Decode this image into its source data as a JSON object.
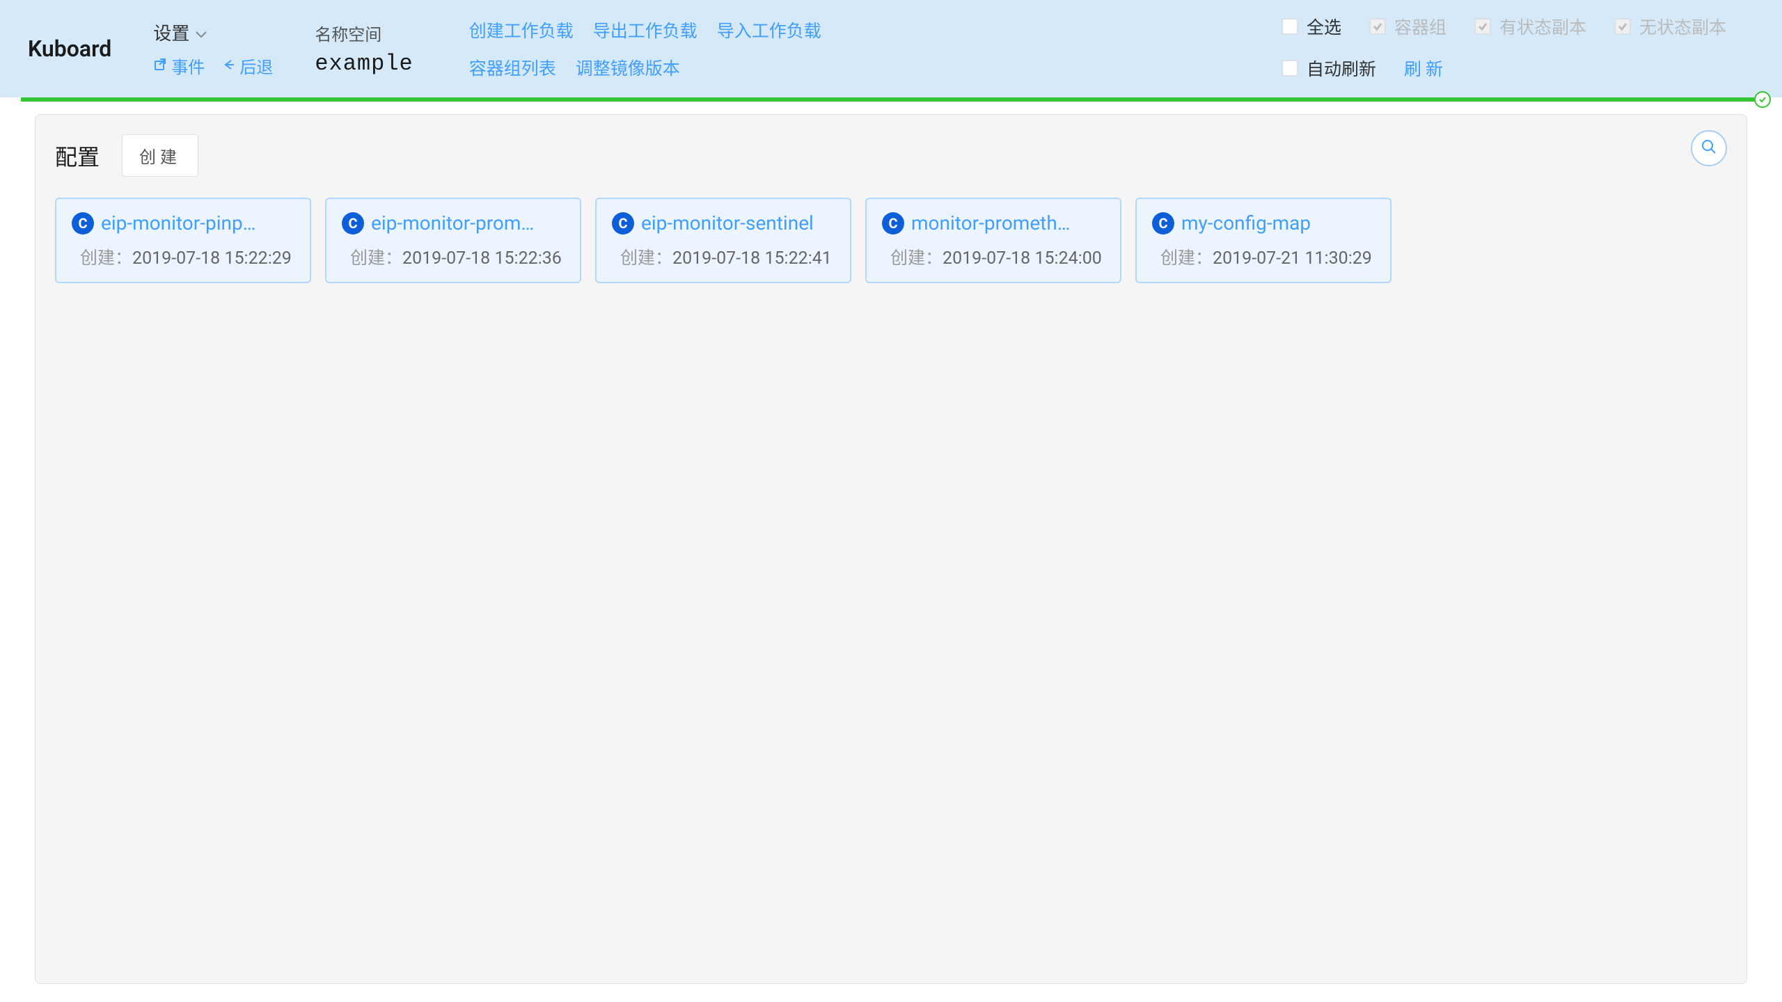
{
  "header": {
    "logo": "Kuboard",
    "settings_label": "设置",
    "events_link": "事件",
    "back_link": "后退",
    "namespace_label": "名称空间",
    "namespace_value": "example",
    "actions": {
      "create_workload": "创建工作负载",
      "export_workload": "导出工作负载",
      "import_workload": "导入工作负载",
      "container_list": "容器组列表",
      "adjust_image": "调整镜像版本"
    },
    "filters": {
      "select_all": "全选",
      "pods": "容器组",
      "statefulset": "有状态副本",
      "stateless": "无状态副本",
      "auto_refresh": "自动刷新",
      "refresh": "刷新"
    }
  },
  "panel": {
    "title": "配置",
    "create_button": "创建",
    "badge_letter": "C",
    "created_label": "创建：",
    "cards": [
      {
        "name": "eip-monitor-pinp…",
        "created": "2019-07-18 15:22:29"
      },
      {
        "name": "eip-monitor-prom…",
        "created": "2019-07-18 15:22:36"
      },
      {
        "name": "eip-monitor-sentinel",
        "created": "2019-07-18 15:22:41"
      },
      {
        "name": "monitor-prometh…",
        "created": "2019-07-18 15:24:00"
      },
      {
        "name": "my-config-map",
        "created": "2019-07-21 11:30:29"
      }
    ]
  }
}
